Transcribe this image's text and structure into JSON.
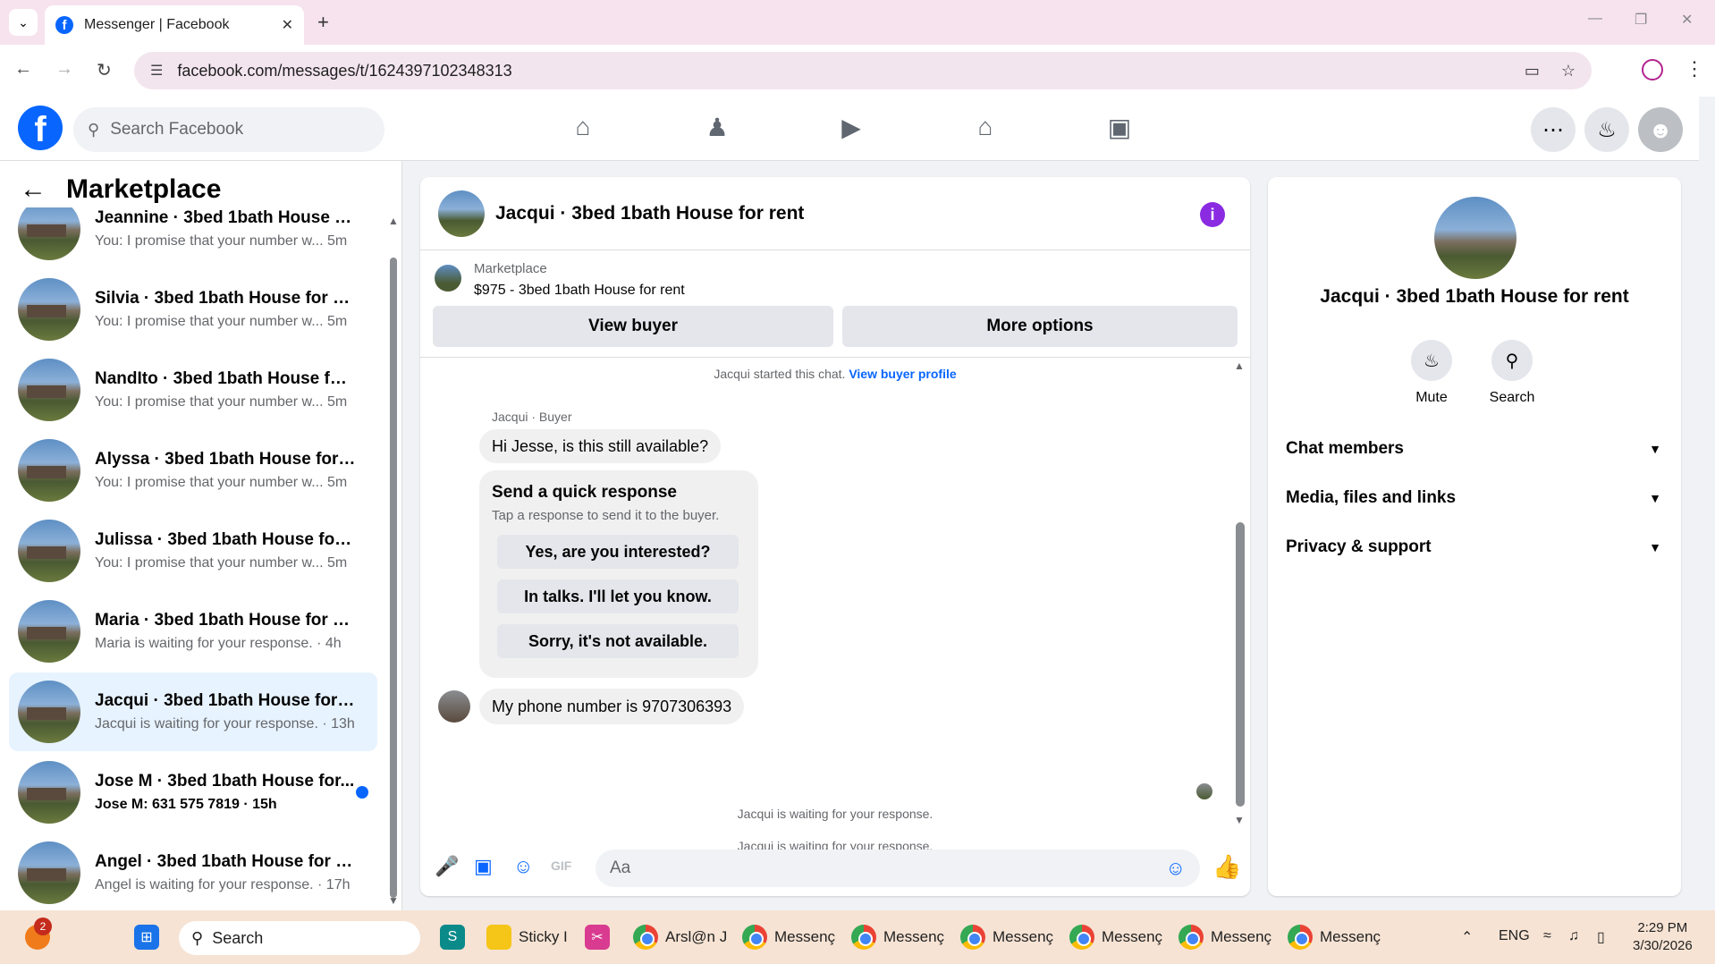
{
  "browser": {
    "tab_title": "Messenger | Facebook",
    "url": "facebook.com/messages/t/1624397102348313"
  },
  "fb_header": {
    "search_placeholder": "Search Facebook"
  },
  "sidebar": {
    "title": "Marketplace",
    "conversations": [
      {
        "name": "Jeannine · 3bed 1bath House for...",
        "preview": "You: I promise that your number w... 5m",
        "unread": false,
        "active": false
      },
      {
        "name": "Silvia · 3bed 1bath House for rent",
        "preview": "You: I promise that your number w... 5m",
        "unread": false,
        "active": false
      },
      {
        "name": "NandIto · 3bed 1bath House for ...",
        "preview": "You: I promise that your number w... 5m",
        "unread": false,
        "active": false
      },
      {
        "name": "Alyssa · 3bed 1bath House for rent",
        "preview": "You: I promise that your number w... 5m",
        "unread": false,
        "active": false
      },
      {
        "name": "Julissa · 3bed 1bath House for re...",
        "preview": "You: I promise that your number w... 5m",
        "unread": false,
        "active": false
      },
      {
        "name": "Maria · 3bed 1bath House for rent",
        "preview": "Maria is waiting for your response. · 4h",
        "unread": false,
        "active": false
      },
      {
        "name": "Jacqui · 3bed 1bath House for rent",
        "preview": "Jacqui is waiting for your response. · 13h",
        "unread": false,
        "active": true
      },
      {
        "name": "Jose M · 3bed 1bath House for...",
        "preview": "Jose M: 631 575 7819 · 15h",
        "unread": true,
        "active": false
      },
      {
        "name": "Angel · 3bed 1bath House for rent",
        "preview": "Angel is waiting for your response. · 17h",
        "unread": false,
        "active": false
      }
    ]
  },
  "chat": {
    "title": "Jacqui · 3bed 1bath House for rent",
    "listing_source": "Marketplace",
    "listing_price": "$975 - 3bed 1bath House for rent",
    "view_buyer_label": "View buyer",
    "more_options_label": "More options",
    "started_text": "Jacqui started this chat.",
    "view_profile_link": "View buyer profile",
    "sender_label": "Jacqui · Buyer",
    "message_1": "Hi Jesse, is this still available?",
    "quick_title": "Send a quick response",
    "quick_subtitle": "Tap a response to send it to the buyer.",
    "quick_options": [
      "Yes, are you interested?",
      "In talks. I'll let you know.",
      "Sorry, it's not available."
    ],
    "message_2": "My phone number is 9707306393",
    "waiting_1": "Jacqui is waiting for your response.",
    "waiting_2": "Jacqui is waiting for your response.",
    "composer_placeholder": "Aa"
  },
  "right_panel": {
    "name": "Jacqui · 3bed 1bath House for rent",
    "mute_label": "Mute",
    "search_label": "Search",
    "sections": [
      "Chat members",
      "Media, files and links",
      "Privacy & support"
    ]
  },
  "taskbar": {
    "notification_count": "2",
    "search_label": "Search",
    "apps": [
      "Sticky I",
      "Arsl@n J",
      "Messenç",
      "Messenç",
      "Messenç",
      "Messenç",
      "Messenç",
      "Messenç"
    ],
    "language": "ENG",
    "time": "2:29 PM",
    "date": "3/30/2026"
  },
  "colors": {
    "accent": "#0866ff",
    "info_purple": "#8a2be2",
    "active_conv_bg": "#e7f3ff"
  }
}
